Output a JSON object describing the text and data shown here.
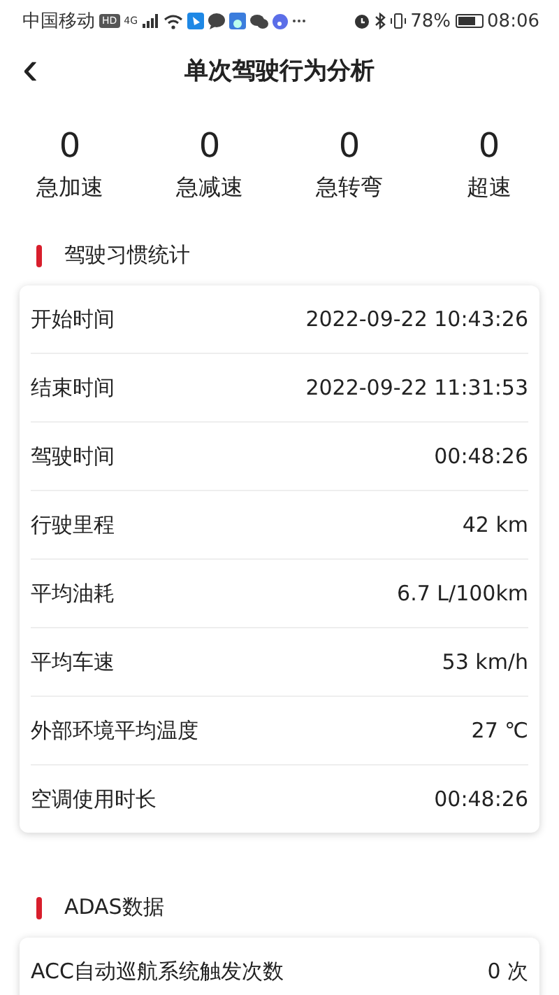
{
  "status_bar": {
    "carrier": "中国移动",
    "hd": "HD",
    "network": "4G",
    "battery_percent": "78%",
    "time": "08:06"
  },
  "header": {
    "back": "‹",
    "title": "单次驾驶行为分析"
  },
  "stats": [
    {
      "value": "0",
      "label": "急加速"
    },
    {
      "value": "0",
      "label": "急减速"
    },
    {
      "value": "0",
      "label": "急转弯"
    },
    {
      "value": "0",
      "label": "超速"
    }
  ],
  "sections": [
    {
      "title": "驾驶习惯统计",
      "rows": [
        {
          "label": "开始时间",
          "value": "2022-09-22 10:43:26"
        },
        {
          "label": "结束时间",
          "value": "2022-09-22 11:31:53"
        },
        {
          "label": "驾驶时间",
          "value": "00:48:26"
        },
        {
          "label": "行驶里程",
          "value": "42 km"
        },
        {
          "label": "平均油耗",
          "value": "6.7 L/100km"
        },
        {
          "label": "平均车速",
          "value": "53 km/h"
        },
        {
          "label": "外部环境平均温度",
          "value": "27 ℃"
        },
        {
          "label": "空调使用时长",
          "value": "00:48:26"
        }
      ]
    },
    {
      "title": "ADAS数据",
      "rows": [
        {
          "label": "ACC自动巡航系统触发次数",
          "value": "0 次"
        }
      ]
    }
  ]
}
